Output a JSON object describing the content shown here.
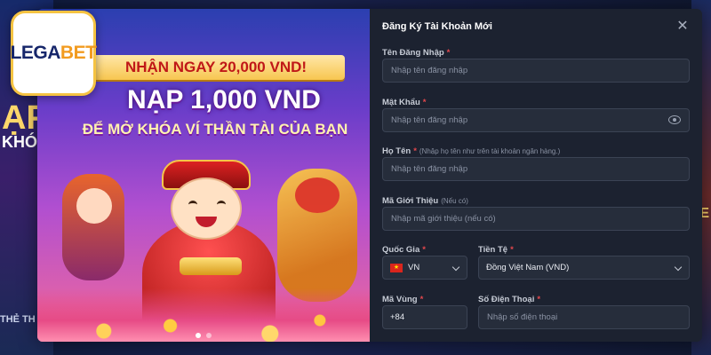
{
  "background": {
    "left_big": "ẠP",
    "left_small": "KHÓA",
    "left_bottom": "THẺ TH",
    "right_big": "E"
  },
  "logo": {
    "text_a": "LEGA",
    "text_b": "BET"
  },
  "promo": {
    "ribbon": "NHẬN NGAY 20,000 VND!",
    "headline": "NẠP 1,000 VND",
    "subline": "ĐỂ MỞ KHÓA VÍ THẦN TÀI CỦA BẠN"
  },
  "form": {
    "title": "Đăng Ký Tài Khoản Mới",
    "close_icon": "close-icon",
    "username": {
      "label": "Tên Đăng Nhập",
      "placeholder": "Nhập tên đăng nhập"
    },
    "password": {
      "label": "Mật Khẩu",
      "placeholder": "Nhập tên đăng nhập"
    },
    "fullname": {
      "label": "Họ Tên",
      "hint": "(Nhập họ tên như trên tài khoản ngân hàng.)",
      "placeholder": "Nhập tên đăng nhập"
    },
    "referral": {
      "label": "Mã Giới Thiệu",
      "hint": "(Nếu có)",
      "placeholder": "Nhập mã giới thiệu (nếu có)"
    },
    "country": {
      "label": "Quốc Gia",
      "value": "VN"
    },
    "currency": {
      "label": "Tiền Tệ",
      "value": "Đồng Việt Nam (VND)"
    },
    "area_code": {
      "label": "Mã Vùng",
      "value": "+84"
    },
    "phone": {
      "label": "Số Điện Thoại",
      "placeholder": "Nhập số điện thoại"
    },
    "required_mark": "*"
  },
  "colors": {
    "accent_gold": "#f5c342",
    "required": "#e5484d",
    "panel": "#1c2230"
  }
}
